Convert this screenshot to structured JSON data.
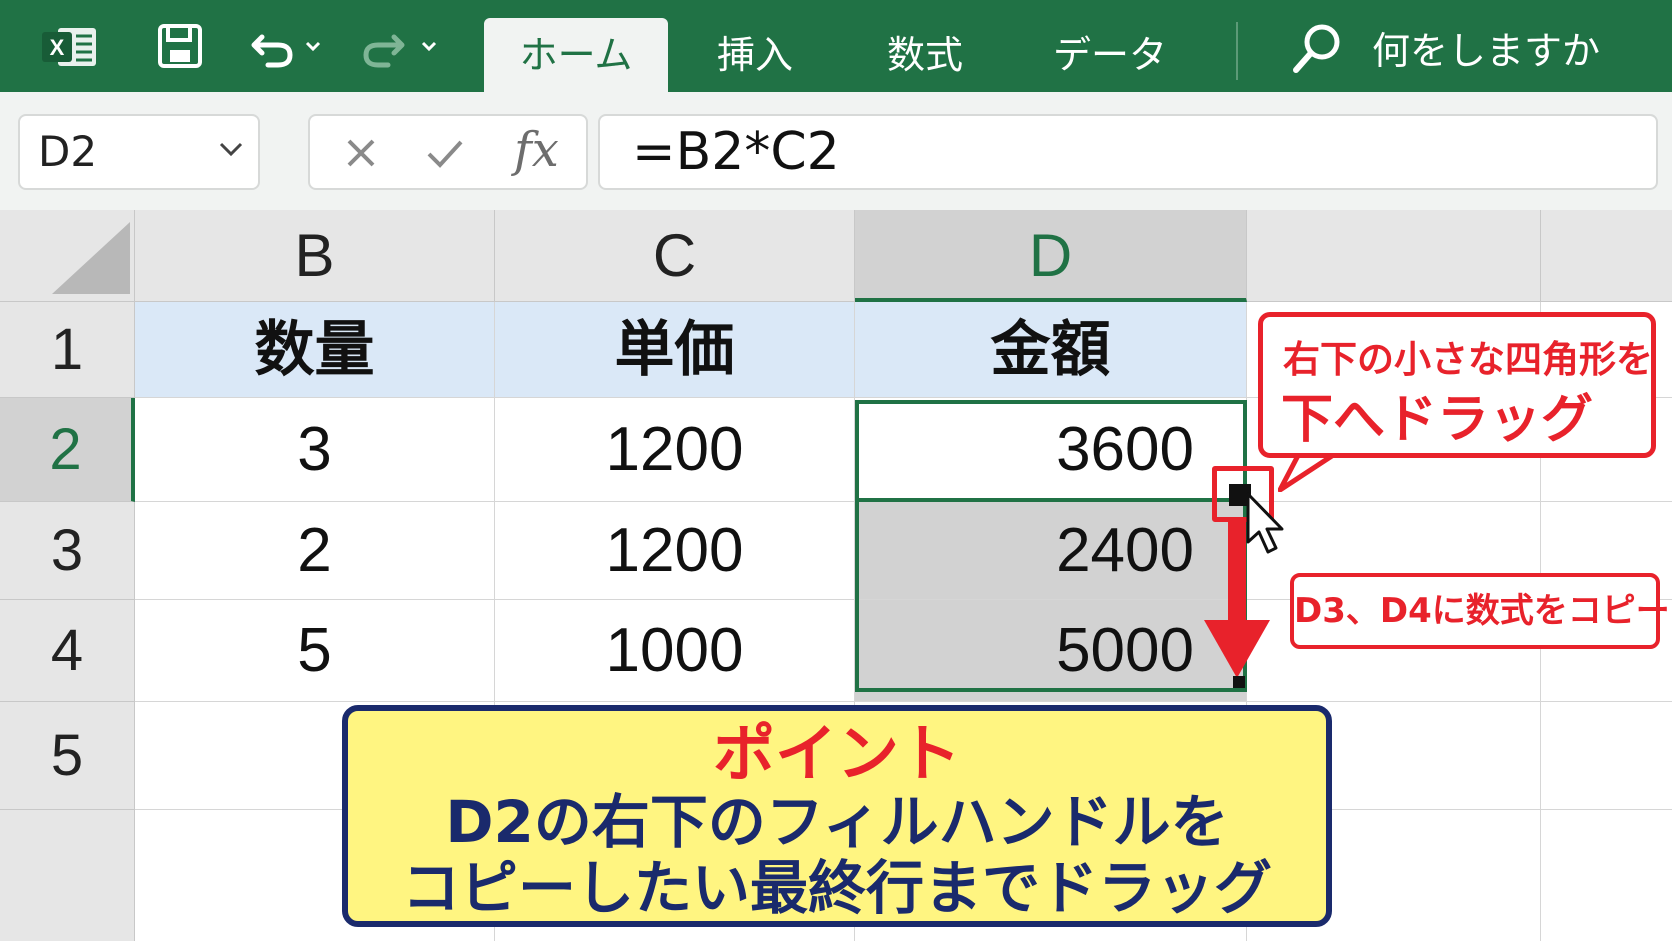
{
  "app": {
    "logo_icon": "excel-logo-icon",
    "quick_access": [
      "save-icon",
      "undo-icon",
      "dropdown-caret-icon",
      "redo-icon",
      "dropdown-caret-icon"
    ]
  },
  "ribbon": {
    "tabs": [
      {
        "label": "ホーム",
        "active": true
      },
      {
        "label": "挿入",
        "active": false
      },
      {
        "label": "数式",
        "active": false
      },
      {
        "label": "データ",
        "active": false
      }
    ],
    "tell_me": "何をしますか"
  },
  "formula_bar": {
    "name_box": "D2",
    "cancel_icon": "close-icon",
    "enter_icon": "check-icon",
    "fx_label": "fx",
    "formula": "=B2*C2"
  },
  "sheet": {
    "columns": [
      "B",
      "C",
      "D"
    ],
    "selected_column": "D",
    "rows": [
      "1",
      "2",
      "3",
      "4",
      "5"
    ],
    "selected_row": "2",
    "header_row": [
      "数量",
      "単価",
      "金額"
    ],
    "data": [
      [
        "3",
        "1200",
        "3600"
      ],
      [
        "2",
        "1200",
        "2400"
      ],
      [
        "5",
        "1000",
        "5000"
      ]
    ],
    "active_cell": "D2",
    "colors": {
      "accent": "#207245",
      "header_fill": "#dae8f7",
      "selection_fill": "#d2d2d2"
    }
  },
  "annotations": {
    "callout1_line1": "右下の小さな四角形を",
    "callout1_line2": "下へドラッグ",
    "callout2": "D3、D4に数式をコピー",
    "point_title": "ポイント",
    "point_line1": "D2の右下のフィルハンドルを",
    "point_line2": "コピーしたい最終行までドラッグ",
    "colors": {
      "red": "#e8222b",
      "navy": "#1a2a6c",
      "yellow": "#fff581"
    }
  }
}
